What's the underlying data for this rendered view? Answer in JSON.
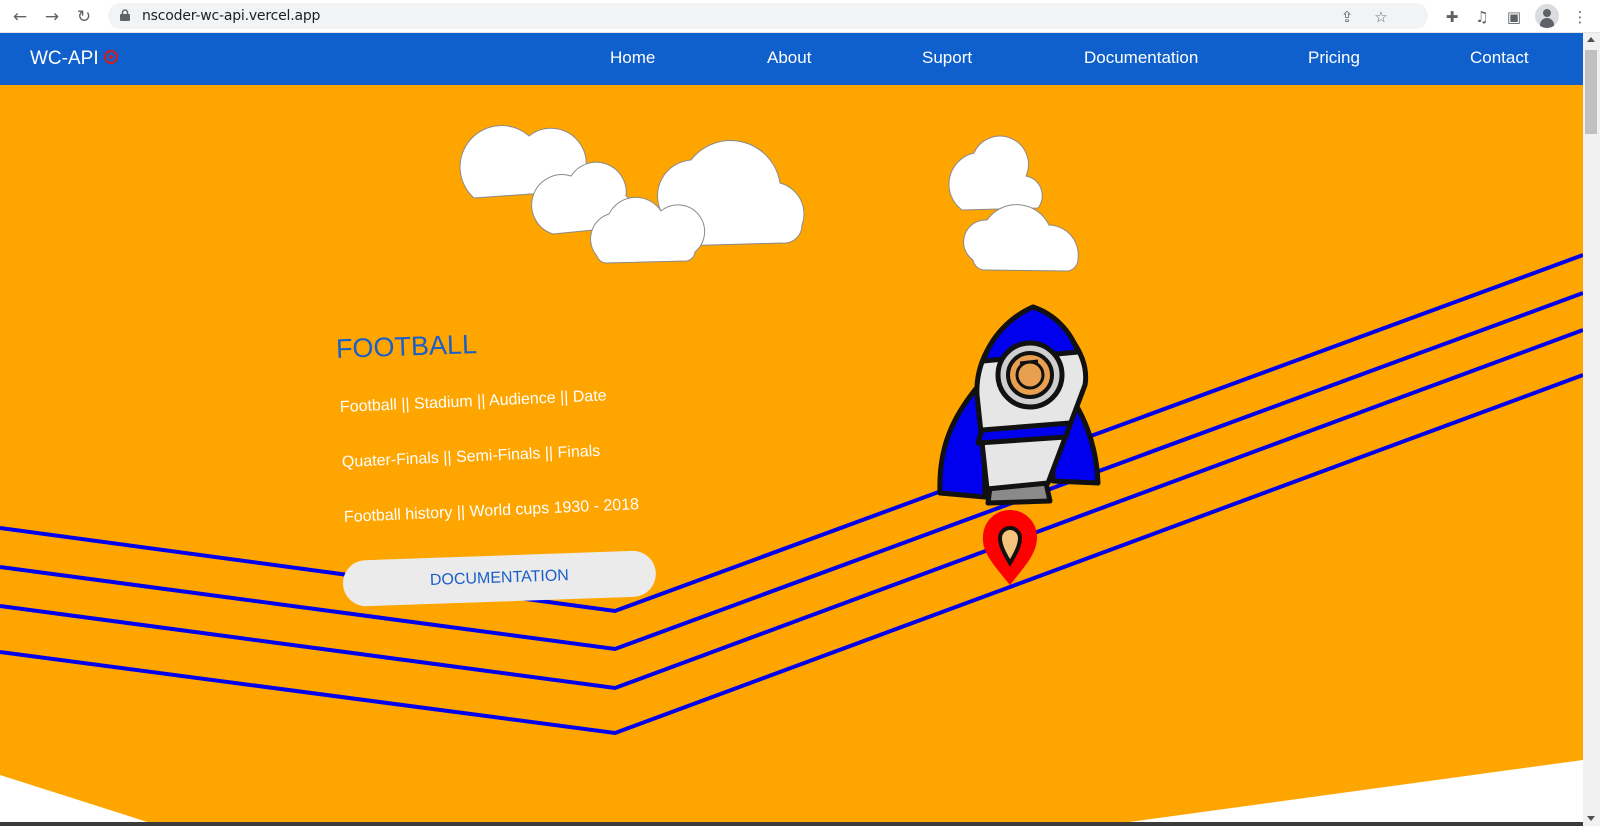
{
  "browser": {
    "back_icon": "arrow-left-icon",
    "forward_icon": "arrow-right-icon",
    "reload_icon": "reload-icon",
    "url": "nscoder-wc-api.vercel.app",
    "toolbar_icons": [
      "share-icon",
      "star-icon",
      "extensions-icon",
      "media-icon",
      "side-panel-icon",
      "profile-icon",
      "menu-icon"
    ]
  },
  "nav": {
    "brand": "WC-API",
    "links": [
      "Home",
      "About",
      "Suport",
      "Documentation",
      "Pricing",
      "Contact"
    ]
  },
  "hero": {
    "title": "FOOTBALL",
    "lines": [
      "Football || Stadium || Audience || Date",
      "Quater-Finals || Semi-Finals || Finals",
      "Football history || World cups 1930 - 2018"
    ],
    "button": "DOCUMENTATION"
  },
  "colors": {
    "nav_bg": "#0f5fcc",
    "hero_bg": "#ffa500",
    "track_lines": "#0000ee",
    "accent_text": "#1a5fc9",
    "pin": "#ff0000"
  }
}
